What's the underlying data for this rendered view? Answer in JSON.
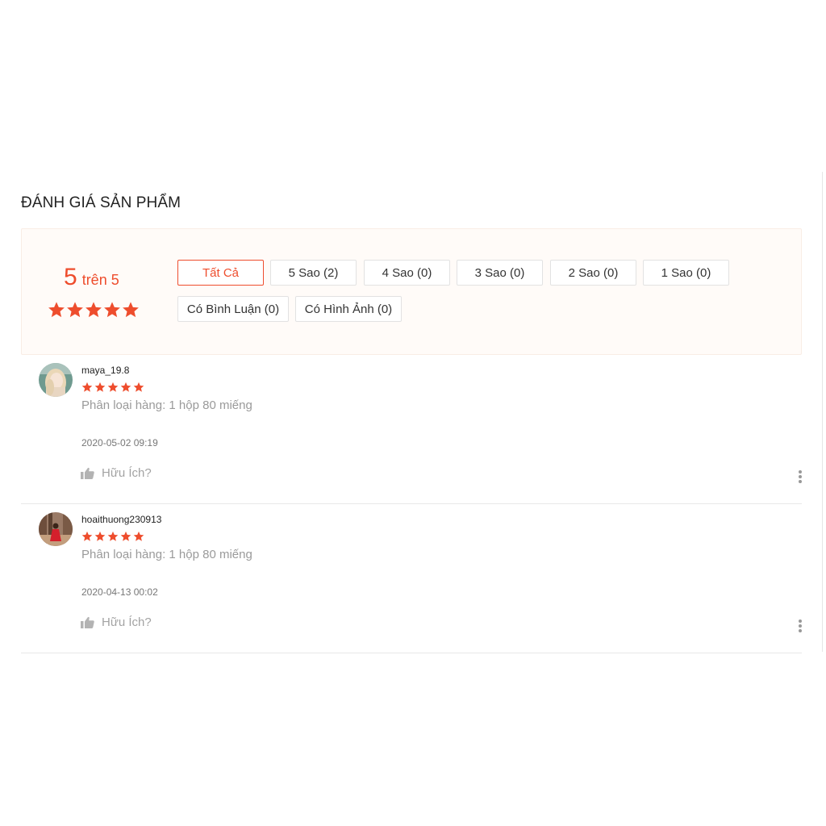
{
  "section": {
    "title": "ĐÁNH GIÁ SẢN PHẨM"
  },
  "overview": {
    "score": "5",
    "score_suffix": "trên 5",
    "stars": 5
  },
  "filters": [
    {
      "label": "Tất Cả",
      "active": true
    },
    {
      "label": "5 Sao (2)",
      "active": false
    },
    {
      "label": "4 Sao (0)",
      "active": false
    },
    {
      "label": "3 Sao (0)",
      "active": false
    },
    {
      "label": "2 Sao (0)",
      "active": false
    },
    {
      "label": "1 Sao (0)",
      "active": false
    },
    {
      "label": "Có Bình Luận (0)",
      "active": false
    },
    {
      "label": "Có Hình Ảnh (0)",
      "active": false
    }
  ],
  "reviews": [
    {
      "username": "maya_19.8",
      "rating": 5,
      "variation": "Phân loại hàng: 1 hộp 80 miếng",
      "time": "2020-05-02 09:19",
      "helpful_label": "Hữu Ích?",
      "avatar": "avatar-blonde-girl"
    },
    {
      "username": "hoaithuong230913",
      "rating": 5,
      "variation": "Phân loại hàng: 1 hộp 80 miếng",
      "time": "2020-04-13 00:02",
      "helpful_label": "Hữu Ích?",
      "avatar": "avatar-red-dress-girl"
    }
  ],
  "icons": {
    "star": "star-icon",
    "helpful": "thumbs-up-icon",
    "more": "more-vertical-icon"
  },
  "colors": {
    "accent": "#ee4d2d",
    "overview_bg": "#fffbf8",
    "muted": "#9a9a9a"
  }
}
